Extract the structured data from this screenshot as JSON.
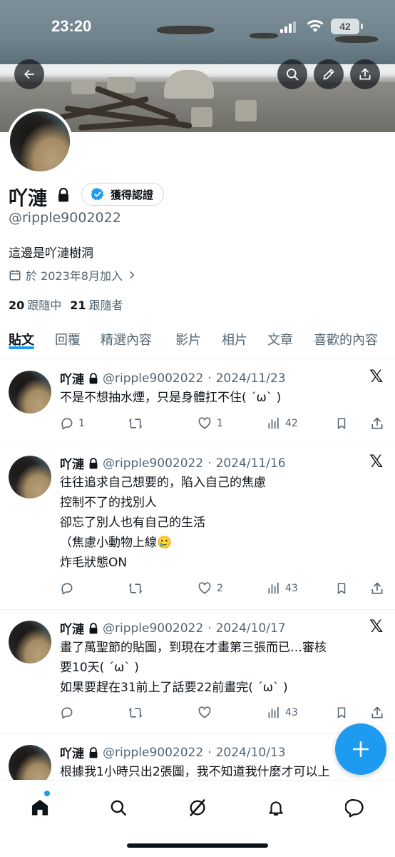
{
  "status_bar": {
    "time": "23:20",
    "battery": "42"
  },
  "profile": {
    "name": "吖漣",
    "verified_label": "獲得認證",
    "handle": "@ripple9002022",
    "bio": "這邊是吖漣樹洞",
    "joined": "於 2023年8月加入",
    "following_count": "20",
    "following_label": "跟隨中",
    "followers_count": "21",
    "followers_label": "跟隨者"
  },
  "tabs": [
    {
      "label": "貼文"
    },
    {
      "label": "回覆"
    },
    {
      "label": "精選內容"
    },
    {
      "label": "影片"
    },
    {
      "label": "相片"
    },
    {
      "label": "文章"
    },
    {
      "label": "喜歡的內容"
    }
  ],
  "tweets": [
    {
      "name": "吖漣",
      "handle": "@ripple9002022",
      "date": "2024/11/23",
      "text": "不是不想抽水煙，只是身體扛不住( ´ω` )",
      "replies": "1",
      "likes": "1",
      "views": "42"
    },
    {
      "name": "吖漣",
      "handle": "@ripple9002022",
      "date": "2024/11/16",
      "text": "往往追求自己想要的，陷入自己的焦慮\n控制不了的找別人\n卻忘了別人也有自己的生活\n（焦慮小動物上線🥲\n炸毛狀態ON",
      "replies": "",
      "likes": "2",
      "views": "43"
    },
    {
      "name": "吖漣",
      "handle": "@ripple9002022",
      "date": "2024/10/17",
      "text": "畫了萬聖節的貼圖，到現在才畫第三張而已…審核\n要10天( ´ω` )\n如果要趕在31前上了話要22前畫完( ´ω` )",
      "replies": "",
      "likes": "",
      "views": "43"
    },
    {
      "name": "吖漣",
      "handle": "@ripple9002022",
      "date": "2024/10/13",
      "text": "根據我1小時只出2張圖，我不知道我什麼才可以上"
    }
  ],
  "icons": {
    "back": "arrow-left-icon",
    "search": "search-icon",
    "edit": "pencil-icon",
    "share": "share-icon",
    "compose": "plus-icon",
    "nav": [
      "home-icon",
      "search-icon",
      "communities-icon",
      "bell-icon",
      "messages-icon"
    ]
  },
  "colors": {
    "accent": "#1d9bf0",
    "text": "#0f1419",
    "secondary": "#536471"
  }
}
